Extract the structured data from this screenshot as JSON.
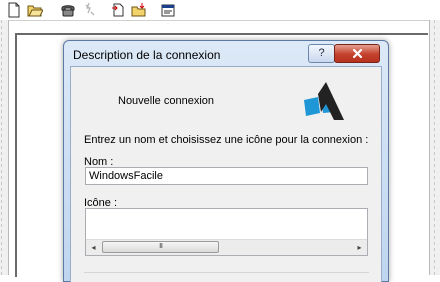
{
  "toolbar": {
    "icons": [
      "new-document-icon",
      "open-folder-icon",
      "phone-icon",
      "disconnect-icon",
      "send-icon",
      "receive-icon",
      "properties-icon"
    ]
  },
  "dialog": {
    "title": "Description de la connexion",
    "help_label": "?",
    "connection_name": "Nouvelle connexion",
    "prompt": "Entrez un nom et choisissez une icône pour la connexion :",
    "name_label": "Nom :",
    "name_value": "WindowsFacile",
    "icon_label": "Icône :",
    "scroll_left": "◂",
    "scroll_right": "▸",
    "scroll_grip": "III"
  },
  "colors": {
    "title_bar": "#c9dbf1",
    "close_button": "#c4402c",
    "logo_blue": "#1f96d6"
  }
}
